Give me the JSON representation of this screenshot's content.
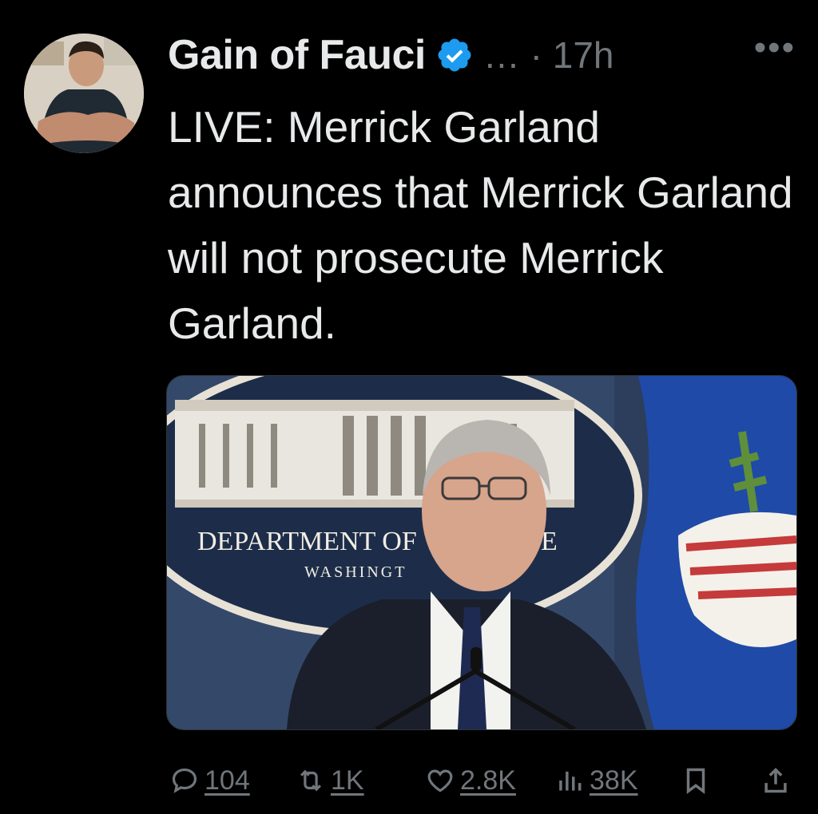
{
  "author": {
    "display_name": "Gain of Fauci",
    "meta": "… · 17h",
    "avatar_icon": "avatar-photo",
    "verified_icon": "verified-badge-icon",
    "verified_color": "#1d9bf0"
  },
  "more_label": "•••",
  "tweet": {
    "text": "LIVE: Merrick Garland announces that Merrick Garland will not prosecute Merrick Garland."
  },
  "media": {
    "seal_line1": "DEPARTMENT OF",
    "seal_line1_end": "E",
    "seal_line2": "WASHINGT"
  },
  "actions": {
    "replies": "104",
    "reposts": "1K",
    "likes": "2.8K",
    "views": "38K"
  },
  "colors": {
    "background": "#000000",
    "text": "#e7e9ea",
    "secondary": "#71767b"
  }
}
